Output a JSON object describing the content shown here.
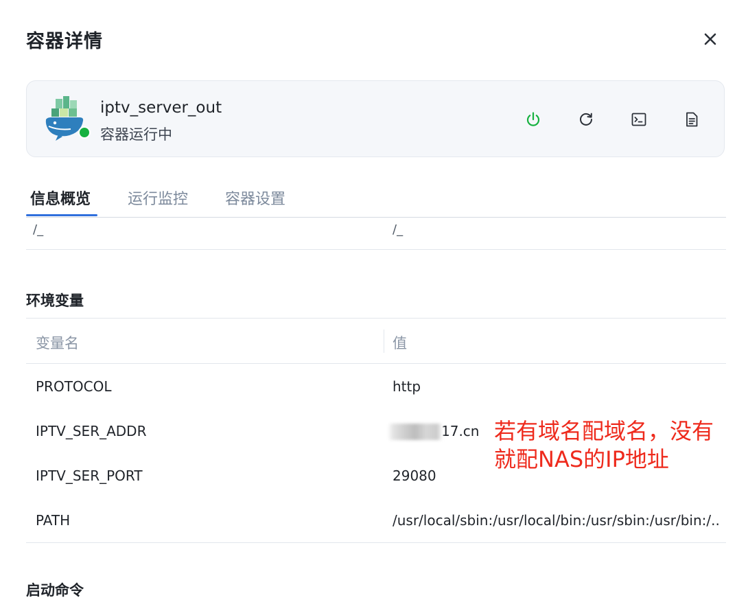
{
  "dialog": {
    "title": "容器详情"
  },
  "container": {
    "name": "iptv_server_out",
    "status": "容器运行中"
  },
  "colors": {
    "running": "#16b13f",
    "accent": "#2f6fdc",
    "annotation": "#ee2a1c"
  },
  "actions": [
    {
      "name": "power-icon"
    },
    {
      "name": "restart-icon"
    },
    {
      "name": "terminal-icon"
    },
    {
      "name": "log-icon"
    }
  ],
  "tabs": [
    {
      "label": "信息概览",
      "active": true
    },
    {
      "label": "运行监控",
      "active": false
    },
    {
      "label": "容器设置",
      "active": false
    }
  ],
  "partial_row": {
    "name": "/_",
    "value": "/_"
  },
  "env": {
    "title": "环境变量",
    "columns": {
      "name": "变量名",
      "value": "值"
    },
    "rows": [
      {
        "name": "PROTOCOL",
        "value": "http"
      },
      {
        "name": "IPTV_SER_ADDR",
        "value": "17.cn"
      },
      {
        "name": "IPTV_SER_PORT",
        "value": "29080"
      },
      {
        "name": "PATH",
        "value": "/usr/local/sbin:/usr/local/bin:/usr/sbin:/usr/bin:/.."
      }
    ]
  },
  "annotation": {
    "line1": "若有域名配域名，没有",
    "line2": "就配NAS的IP地址"
  },
  "startup": {
    "title": "启动命令"
  }
}
